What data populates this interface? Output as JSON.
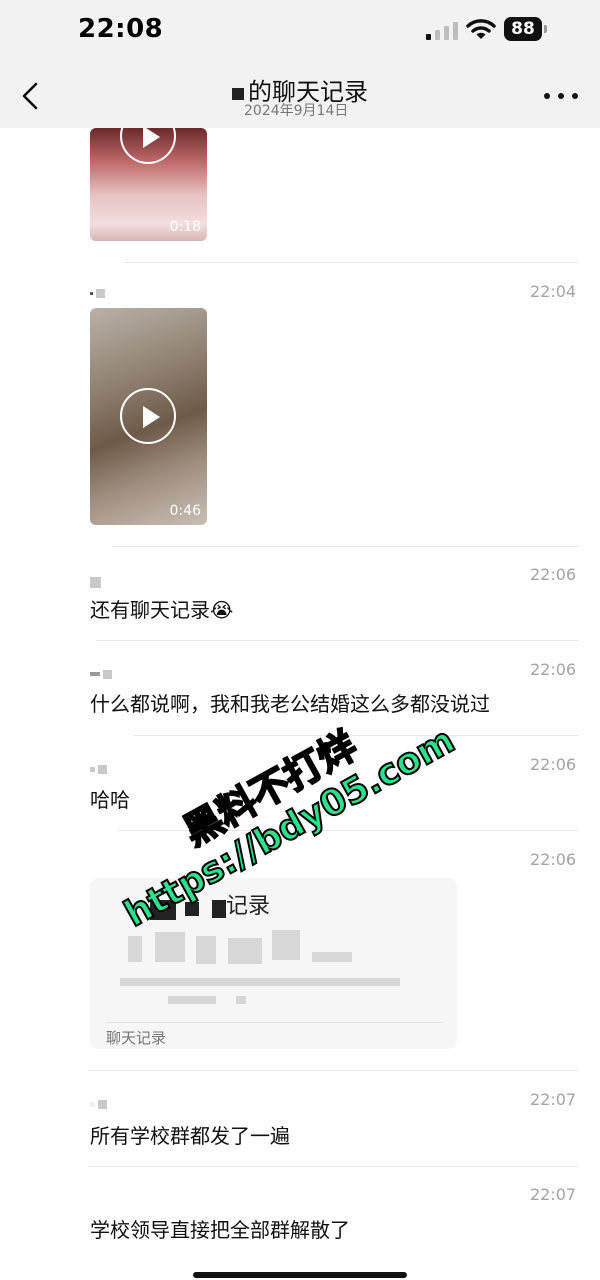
{
  "status_bar": {
    "time": "22:08",
    "battery": "88"
  },
  "nav": {
    "title": "的聊天记录",
    "date": "2024年9月14日"
  },
  "messages": [
    {
      "type": "video",
      "duration": "0:18"
    },
    {
      "type": "video",
      "time": "22:04",
      "duration": "0:46"
    },
    {
      "type": "text",
      "time": "22:06",
      "text": "还有聊天记录😭"
    },
    {
      "type": "text",
      "time": "22:06",
      "text": "什么都说啊，我和我老公结婚这么多都没说过"
    },
    {
      "type": "text",
      "time": "22:06",
      "text": "哈哈"
    },
    {
      "type": "chat_record",
      "time": "22:06",
      "title_visible": "记录",
      "footer": "聊天记录"
    },
    {
      "type": "text",
      "time": "22:07",
      "text": "所有学校群都发了一遍"
    },
    {
      "type": "text",
      "time": "22:07",
      "text": "学校领导直接把全部群解散了"
    }
  ],
  "watermark": {
    "line1": "黑料不打烊",
    "line2": "https://bdy05.com"
  }
}
